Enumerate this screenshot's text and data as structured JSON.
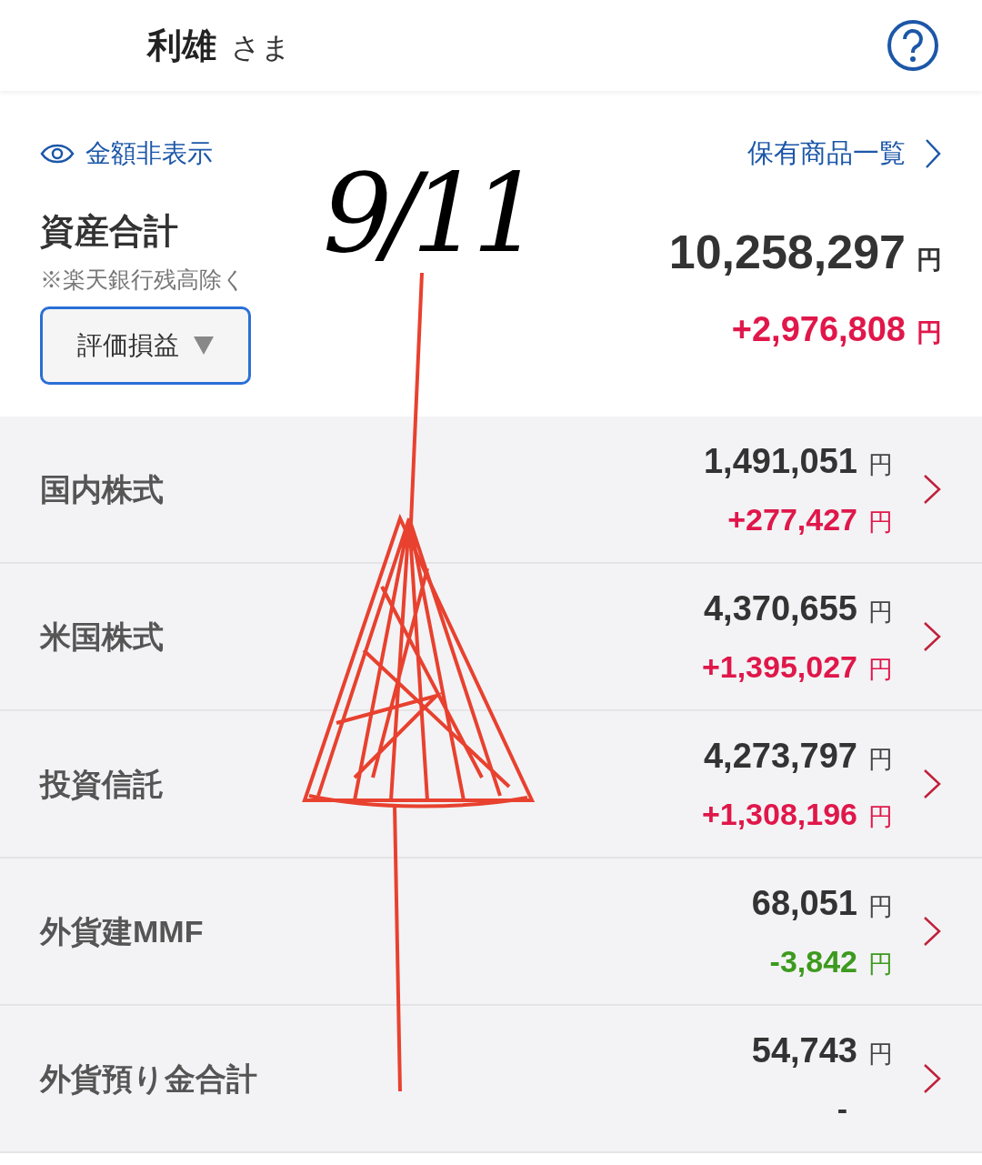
{
  "header": {
    "name": "利雄",
    "honorific": "さま"
  },
  "summary": {
    "hide_amounts": "金額非表示",
    "holdings_link": "保有商品一覧",
    "title": "資産合計",
    "note": "※楽天銀行残高除く",
    "dropdown": "評価損益",
    "total": "10,258,297",
    "total_unit": "円",
    "gain": "+2,976,808",
    "gain_unit": "円"
  },
  "rows": [
    {
      "label": "国内株式",
      "amount": "1,491,051",
      "amount_unit": "円",
      "gain": "+277,427",
      "gain_unit": "円",
      "color": "#e0174a"
    },
    {
      "label": "米国株式",
      "amount": "4,370,655",
      "amount_unit": "円",
      "gain": "+1,395,027",
      "gain_unit": "円",
      "color": "#e0174a"
    },
    {
      "label": "投資信託",
      "amount": "4,273,797",
      "amount_unit": "円",
      "gain": "+1,308,196",
      "gain_unit": "円",
      "color": "#e0174a"
    },
    {
      "label": "外貨建MMF",
      "amount": "68,051",
      "amount_unit": "円",
      "gain": "-3,842",
      "gain_unit": "円",
      "color": "#3d9a1e"
    },
    {
      "label": "外貨預り金合計",
      "amount": "54,743",
      "amount_unit": "円",
      "gain": "-",
      "color": "#333333"
    }
  ],
  "annotation": {
    "text": "9/11"
  }
}
